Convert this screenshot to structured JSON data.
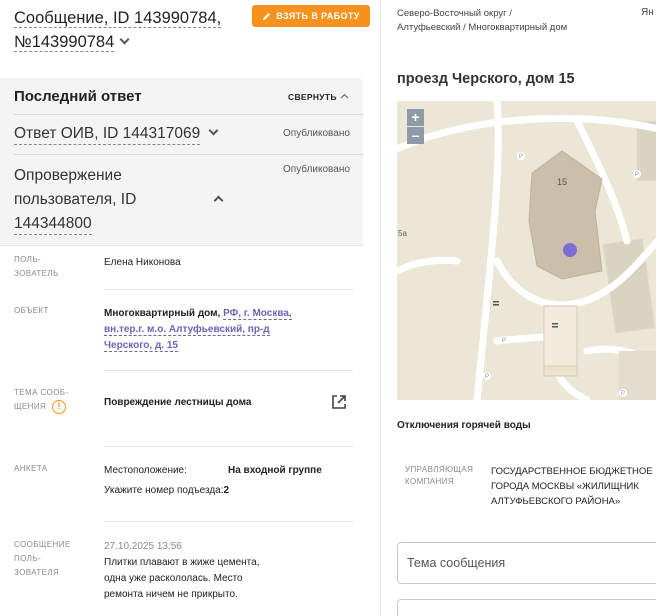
{
  "header": {
    "message_title_line1": "Сообщение, ID 143990784,",
    "message_title_line2": "№143990784",
    "take_button": "ВЗЯТЬ В РАБОТУ"
  },
  "last_answer": {
    "title": "Последний ответ",
    "collapse_label": "СВЕРНУТЬ",
    "answers": [
      {
        "title": "Ответ ОИВ, ID 144317069",
        "status": "Опубликовано"
      },
      {
        "title_line1": "Опровержение",
        "title_line2": "пользователя, ID",
        "title_line3": "144344800",
        "status": "Опубликовано"
      }
    ]
  },
  "fields": {
    "user_label": "ПОЛЬ- ЗОВАТЕЛЬ",
    "user_value": "Елена Никонова",
    "object_label": "ОБЪЕКТ",
    "object_prefix": "Многоквартирный дом, ",
    "object_link": "РФ, г. Москва, вн.тер.г. м.о. Алтуфьевский, пр-д Черского, д. 15",
    "topic_label": "ТЕМА СООБ- ЩЕНИЯ",
    "topic_value": "Повреждение лестницы дома",
    "form_label": "АНКЕТА",
    "form_location_label": "Местоположение:",
    "form_location_value": "На входной группе",
    "form_entrance_label": "Укажите номер подъезда:",
    "form_entrance_value": "2",
    "user_message_label": "СООБЩЕНИЕ ПОЛЬ- ЗОВАТЕЛЯ",
    "user_message_date": "27.10.2025 13:56",
    "user_message_text": "Плитки плавают в жиже цемента, одна уже раскололась. Место ремонта ничем не прикрыто."
  },
  "right": {
    "breadcrumb": "Северо-Восточный округ / Алтуфьевский / Многоквартирный дом",
    "truncated": "Ян",
    "address": "проезд Черского, дом 15",
    "map": {
      "zoom_in": "+",
      "zoom_out": "–",
      "building_number": "15",
      "side_label": "5а",
      "parking_symbol": "P"
    },
    "outage": "Отключения горячей воды",
    "mgmt_label": "УПРАВЛЯЮЩАЯ КОМПАНИЯ",
    "mgmt_value_line1": "ГОСУДАРСТВЕННОЕ БЮДЖЕТНОЕ",
    "mgmt_value_line2": "ГОРОДА МОСКВЫ «ЖИЛИЩНИК",
    "mgmt_value_line3": "АЛТУФЬЕВСКОГО РАЙОНА»",
    "theme_placeholder": "Тема сообщения"
  },
  "colors": {
    "accent_orange": "#f7921e",
    "link_purple": "#6b63b5",
    "map_marker": "#7b6fd6"
  },
  "icons": [
    "pencil-icon",
    "chevron-down-icon",
    "chevron-up-icon",
    "warning-icon",
    "external-link-icon",
    "plus-icon",
    "minus-icon"
  ]
}
